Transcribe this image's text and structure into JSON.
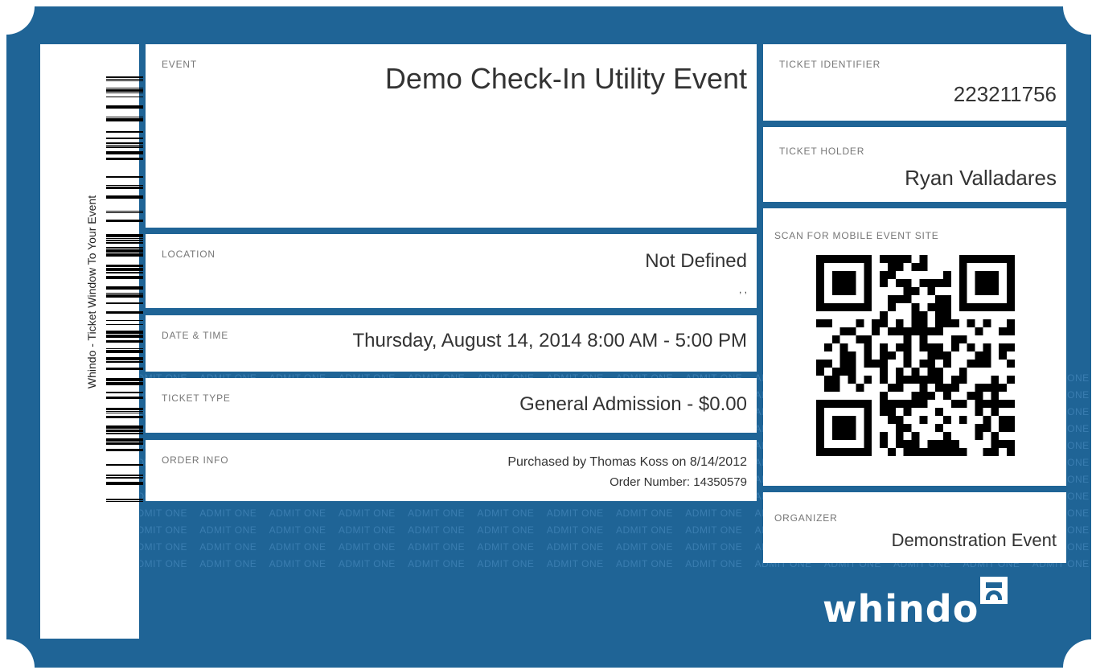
{
  "stub": {
    "caption": "Whindo - Ticket Window To Your Event"
  },
  "pattern": {
    "text": "ADMIT ONE"
  },
  "event": {
    "label": "EVENT",
    "value": "Demo Check-In Utility Event"
  },
  "location": {
    "label": "LOCATION",
    "value": "Not Defined",
    "address": ", ,"
  },
  "datetime": {
    "label": "DATE & TIME",
    "value": "Thursday, August 14, 2014 8:00 AM - 5:00 PM"
  },
  "ticket_type": {
    "label": "TICKET TYPE",
    "value": "General Admission - $0.00"
  },
  "order": {
    "label": "ORDER INFO",
    "purchased": "Purchased by Thomas Koss on 8/14/2012",
    "number": "Order Number: 14350579"
  },
  "ticket_identifier": {
    "label": "TICKET IDENTIFIER",
    "value": "223211756"
  },
  "ticket_holder": {
    "label": "TICKET HOLDER",
    "value": "Ryan Valladares"
  },
  "qr": {
    "label": "SCAN FOR MOBILE EVENT SITE"
  },
  "organizer": {
    "label": "ORGANIZER",
    "value": "Demonstration Event"
  },
  "brand": {
    "name": "whindo",
    "color": "#1f6496"
  }
}
